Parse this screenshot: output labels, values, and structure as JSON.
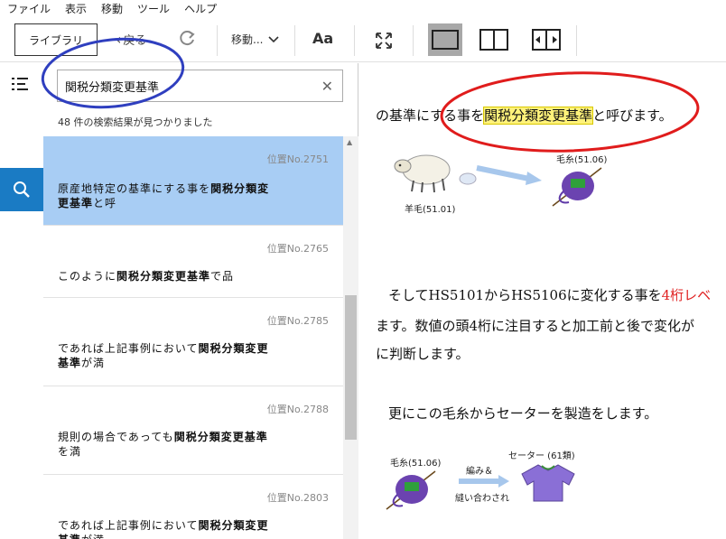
{
  "menu": [
    "ファイル",
    "表示",
    "移動",
    "ツール",
    "ヘルプ"
  ],
  "toolbar": {
    "library_label": "ライブラリ",
    "back_label": "戻る",
    "goto_label": "移動...",
    "font_label": "Aa"
  },
  "search": {
    "query": "関税分類変更基準",
    "result_count_text": "48 件の検索結果が見つかりました",
    "results": [
      {
        "location": "位置No.2751",
        "line1_pre": "原産地特定の基準にする事を",
        "line1_bold": "関税分類変",
        "line2_bold": "更基準",
        "line2_post": "と呼"
      },
      {
        "location": "位置No.2765",
        "line1_pre": "このように",
        "line1_bold": "関税分類変更基準",
        "line1_post": "で品"
      },
      {
        "location": "位置No.2785",
        "line1_pre": "であれば上記事例において",
        "line1_bold": "関税分類変更",
        "line2_bold": "基準",
        "line2_post": "が満"
      },
      {
        "location": "位置No.2788",
        "line1_pre": "規則の場合であっても",
        "line1_bold": "関税分類変更基準",
        "line2_post": "を満"
      },
      {
        "location": "位置No.2803",
        "line1_pre": "であれば上記事例において",
        "line1_bold": "関税分類変更",
        "line2_bold": "基準",
        "line2_post": "が満"
      }
    ]
  },
  "reader": {
    "line1_pre": "の基準にする事を",
    "line1_hl": "関税分類変更基準",
    "line1_post": "と呼びます。",
    "fig1_sheep_caption": "羊毛(51.01)",
    "fig1_yarn_caption": "毛糸(51.06)",
    "para2_line1_pre": "そしてHS5101からHS5106に変化する事を",
    "para2_line1_red": "4桁レベ",
    "para2_line2": "ます。数値の頭4桁に注目すると加工前と後で変化が",
    "para2_line3": "に判断します。",
    "para3_line1": "更にこの毛糸からセーターを製造をします。",
    "fig2_yarn_caption": "毛糸(51.06)",
    "fig2_arrow_top": "編み＆",
    "fig2_arrow_bottom": "縫い合わされ",
    "fig2_sweater_caption": "セーター (61類)"
  },
  "colors": {
    "accent": "#1a7bc4",
    "selected_result": "#a8cdf4",
    "highlight": "#fff27a",
    "annotation_blue": "#2f3fbf",
    "annotation_red": "#e01c1c"
  }
}
